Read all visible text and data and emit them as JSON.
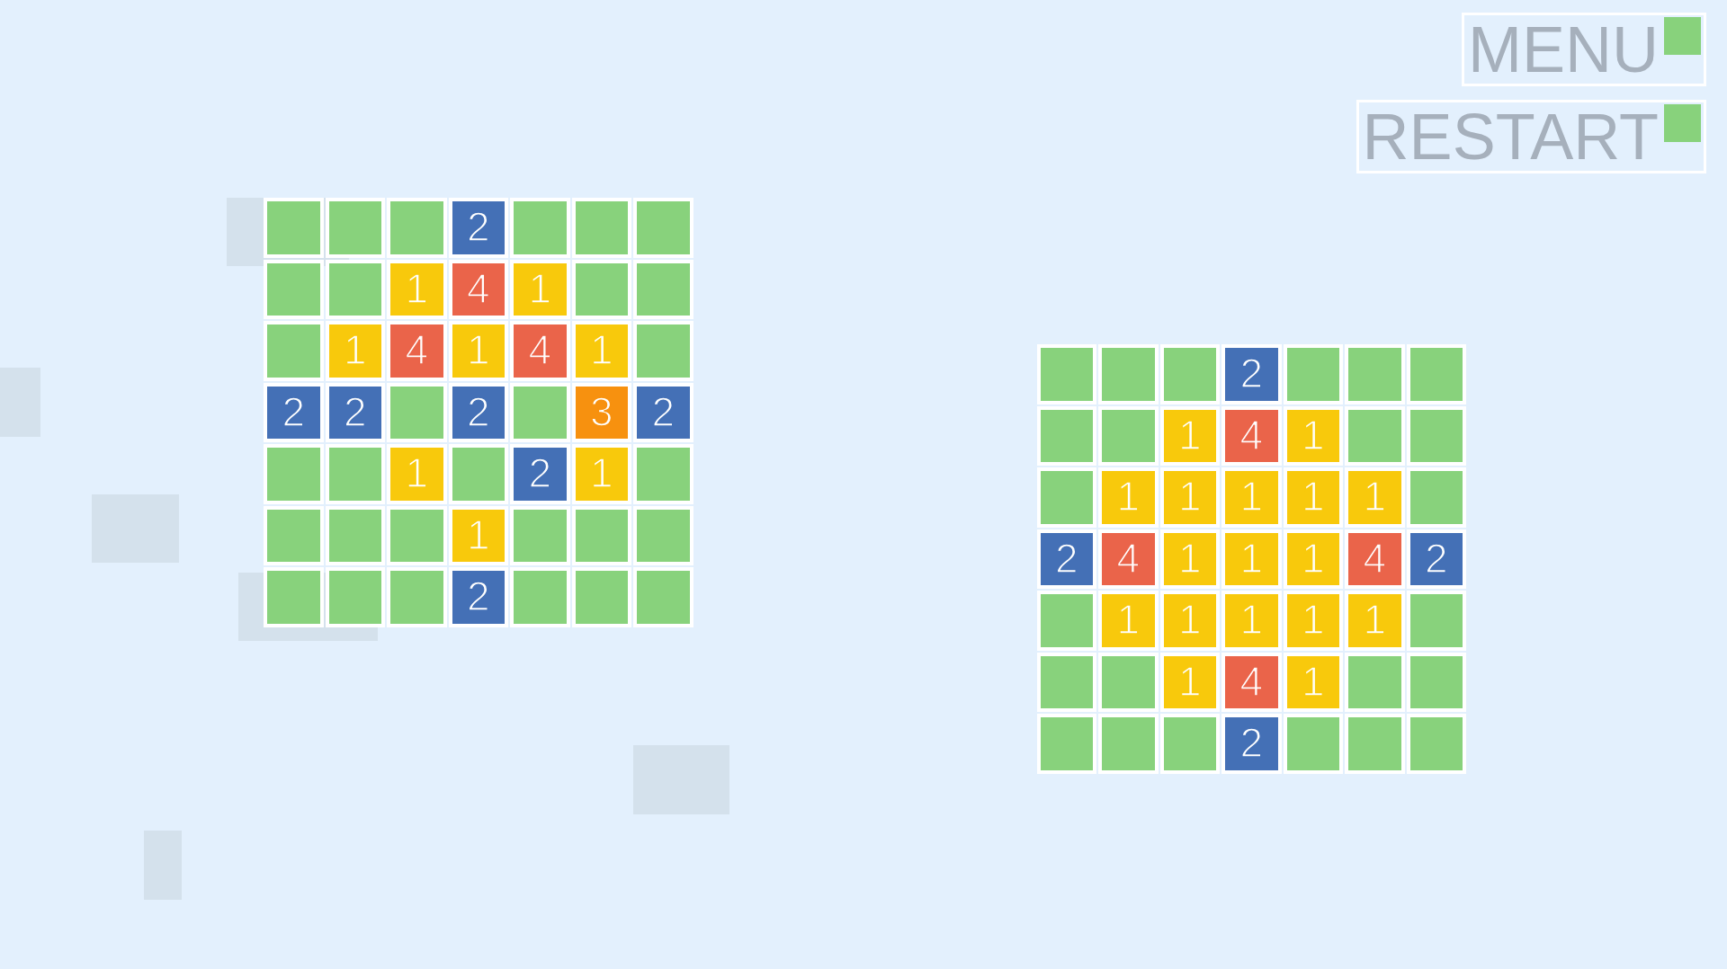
{
  "menu_buttons": [
    {
      "label": "MENU"
    },
    {
      "label": "RESTART"
    }
  ],
  "boards": [
    {
      "rows": [
        [
          {
            "color": "#88d27c"
          },
          {
            "color": "#88d27c"
          },
          {
            "color": "#88d27c"
          },
          {
            "value": "2",
            "color": "#4470b6"
          },
          {
            "color": "#88d27c"
          },
          {
            "color": "#88d27c"
          },
          {
            "color": "#88d27c"
          }
        ],
        [
          {
            "color": "#88d27c"
          },
          {
            "color": "#88d27c"
          },
          {
            "value": "1",
            "color": "#f8c90c"
          },
          {
            "value": "4",
            "color": "#ea644a"
          },
          {
            "value": "1",
            "color": "#f8c90c"
          },
          {
            "color": "#88d27c"
          },
          {
            "color": "#88d27c"
          }
        ],
        [
          {
            "color": "#88d27c"
          },
          {
            "value": "1",
            "color": "#f8c90c"
          },
          {
            "value": "4",
            "color": "#ea644a"
          },
          {
            "value": "1",
            "color": "#f8c90c"
          },
          {
            "value": "4",
            "color": "#ea644a"
          },
          {
            "value": "1",
            "color": "#f8c90c"
          },
          {
            "color": "#88d27c"
          }
        ],
        [
          {
            "value": "2",
            "color": "#4470b6"
          },
          {
            "value": "2",
            "color": "#4470b6"
          },
          {
            "color": "#88d27c"
          },
          {
            "value": "2",
            "color": "#4470b6"
          },
          {
            "color": "#88d27c"
          },
          {
            "value": "3",
            "color": "#f7910f"
          },
          {
            "value": "2",
            "color": "#4470b6"
          }
        ],
        [
          {
            "color": "#88d27c"
          },
          {
            "color": "#88d27c"
          },
          {
            "value": "1",
            "color": "#f8c90c"
          },
          {
            "color": "#88d27c"
          },
          {
            "value": "2",
            "color": "#4470b6"
          },
          {
            "value": "1",
            "color": "#f8c90c"
          },
          {
            "color": "#88d27c"
          }
        ],
        [
          {
            "color": "#88d27c"
          },
          {
            "color": "#88d27c"
          },
          {
            "color": "#88d27c"
          },
          {
            "value": "1",
            "color": "#f8c90c"
          },
          {
            "color": "#88d27c"
          },
          {
            "color": "#88d27c"
          },
          {
            "color": "#88d27c"
          }
        ],
        [
          {
            "color": "#88d27c"
          },
          {
            "color": "#88d27c"
          },
          {
            "color": "#88d27c"
          },
          {
            "value": "2",
            "color": "#4470b6"
          },
          {
            "color": "#88d27c"
          },
          {
            "color": "#88d27c"
          },
          {
            "color": "#88d27c"
          }
        ]
      ]
    },
    {
      "rows": [
        [
          {
            "color": "#88d27c"
          },
          {
            "color": "#88d27c"
          },
          {
            "color": "#88d27c"
          },
          {
            "value": "2",
            "color": "#4470b6"
          },
          {
            "color": "#88d27c"
          },
          {
            "color": "#88d27c"
          },
          {
            "color": "#88d27c"
          }
        ],
        [
          {
            "color": "#88d27c"
          },
          {
            "color": "#88d27c"
          },
          {
            "value": "1",
            "color": "#f8c90c"
          },
          {
            "value": "4",
            "color": "#ea644a"
          },
          {
            "value": "1",
            "color": "#f8c90c"
          },
          {
            "color": "#88d27c"
          },
          {
            "color": "#88d27c"
          }
        ],
        [
          {
            "color": "#88d27c"
          },
          {
            "value": "1",
            "color": "#f8c90c"
          },
          {
            "value": "1",
            "color": "#f8c90c"
          },
          {
            "value": "1",
            "color": "#f8c90c"
          },
          {
            "value": "1",
            "color": "#f8c90c"
          },
          {
            "value": "1",
            "color": "#f8c90c"
          },
          {
            "color": "#88d27c"
          }
        ],
        [
          {
            "value": "2",
            "color": "#4470b6"
          },
          {
            "value": "4",
            "color": "#ea644a"
          },
          {
            "value": "1",
            "color": "#f8c90c"
          },
          {
            "value": "1",
            "color": "#f8c90c"
          },
          {
            "value": "1",
            "color": "#f8c90c"
          },
          {
            "value": "4",
            "color": "#ea644a"
          },
          {
            "value": "2",
            "color": "#4470b6"
          }
        ],
        [
          {
            "color": "#88d27c"
          },
          {
            "value": "1",
            "color": "#f8c90c"
          },
          {
            "value": "1",
            "color": "#f8c90c"
          },
          {
            "value": "1",
            "color": "#f8c90c"
          },
          {
            "value": "1",
            "color": "#f8c90c"
          },
          {
            "value": "1",
            "color": "#f8c90c"
          },
          {
            "color": "#88d27c"
          }
        ],
        [
          {
            "color": "#88d27c"
          },
          {
            "color": "#88d27c"
          },
          {
            "value": "1",
            "color": "#f8c90c"
          },
          {
            "value": "4",
            "color": "#ea644a"
          },
          {
            "value": "1",
            "color": "#f8c90c"
          },
          {
            "color": "#88d27c"
          },
          {
            "color": "#88d27c"
          }
        ],
        [
          {
            "color": "#88d27c"
          },
          {
            "color": "#88d27c"
          },
          {
            "color": "#88d27c"
          },
          {
            "value": "2",
            "color": "#4470b6"
          },
          {
            "color": "#88d27c"
          },
          {
            "color": "#88d27c"
          },
          {
            "color": "#88d27c"
          }
        ]
      ]
    }
  ]
}
